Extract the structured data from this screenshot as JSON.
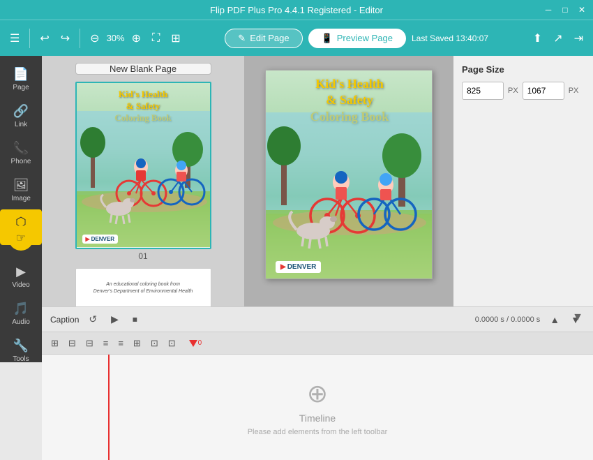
{
  "app": {
    "title": "Flip PDF Plus Pro 4.4.1 Registered - Editor"
  },
  "titlebar": {
    "title": "Flip PDF Plus Pro 4.4.1 Registered - Editor",
    "minimize_icon": "─",
    "maximize_icon": "□",
    "close_icon": "✕"
  },
  "toolbar": {
    "hamburger_label": "☰",
    "undo_label": "↩",
    "redo_label": "↪",
    "zoom_out_label": "⊖",
    "zoom_percent": "30%",
    "zoom_in_label": "⊕",
    "fit_icon": "⛶",
    "view_icon": "⊞",
    "edit_page_label": "Edit Page",
    "preview_page_label": "Preview Page",
    "last_saved_label": "Last Saved 13:40:07",
    "import_icon": "⬆",
    "export_icon": "↗",
    "share_icon": "⇥"
  },
  "sidenav": {
    "items": [
      {
        "id": "page",
        "label": "Page",
        "icon": "📄"
      },
      {
        "id": "link",
        "label": "Link",
        "icon": "🔗"
      },
      {
        "id": "phone",
        "label": "Phone",
        "icon": "📞"
      },
      {
        "id": "image",
        "label": "Image",
        "icon": "🖼"
      },
      {
        "id": "shape",
        "label": "Shape",
        "icon": "⬡"
      },
      {
        "id": "video",
        "label": "Video",
        "icon": "▶"
      },
      {
        "id": "audio",
        "label": "Audio",
        "icon": "🎵"
      },
      {
        "id": "tools",
        "label": "Tools",
        "icon": "🔧"
      }
    ]
  },
  "pages_panel": {
    "new_blank_btn": "New Blank Page",
    "page1_num": "01",
    "page2_text_line1": "An educational coloring book from",
    "page2_text_line2": "Denver's Department of Environmental Health"
  },
  "right_panel": {
    "page_size_label": "Page Size",
    "width_value": "825",
    "height_value": "1067",
    "px_label1": "PX",
    "px_label2": "PX"
  },
  "caption_bar": {
    "label": "Caption",
    "rewind_icon": "↺",
    "play_icon": "▶",
    "stop_icon": "⏹",
    "time_display": "0.0000 s / 0.0000 s",
    "vol_up_icon": "▲",
    "vol_down_icon": "▼",
    "collapse_icon": "▼"
  },
  "timeline_toolbar": {
    "icons": [
      "⊞",
      "⊞",
      "⊟",
      "⊟",
      "⊡",
      "⊡",
      "⊡",
      "⊡"
    ]
  },
  "timeline": {
    "icon": "⊕",
    "title": "Timeline",
    "message": "Please add elements from the left toolbar"
  },
  "cover": {
    "title_line1": "Kid's Health",
    "title_line2": "& Safety",
    "title_line3": "Coloring Book",
    "denver_label": "▶ DENVER"
  }
}
